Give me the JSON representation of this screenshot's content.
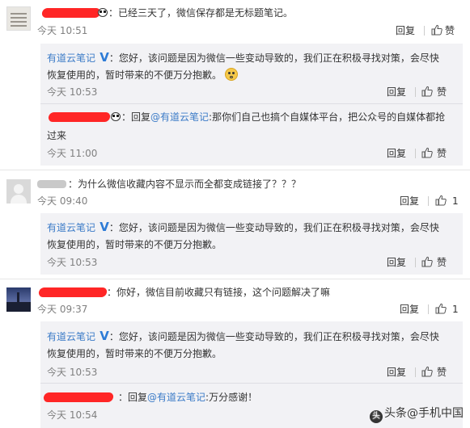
{
  "reply_label": "回复",
  "comments": [
    {
      "text": "已经三天了，微信保存都是无标题笔记。",
      "time": "今天 10:51",
      "replies": [
        {
          "author": "有道云笔记",
          "line1": "您好，该问题是因为微信一些变动导致的，我们正在积极寻找对策，会尽快",
          "line2": "恢复使用的，暂时带来的不便万分抱歉。",
          "time": "今天 10:53"
        },
        {
          "prefix": "回复",
          "mention": "@有道云笔记",
          "line1": ":那你们自己也搞个自媒体平台，把公众号的自媒体都抢",
          "line2": "过来",
          "time": "今天 11:00"
        }
      ]
    },
    {
      "text": "为什么微信收藏内容不显示而全都变成链接了？？？",
      "time": "今天 09:40",
      "likes": "1",
      "replies": [
        {
          "author": "有道云笔记",
          "line1": "您好，该问题是因为微信一些变动导致的，我们正在积极寻找对策，会尽快",
          "line2": "恢复使用的，暂时带来的不便万分抱歉。",
          "time": "今天 10:53"
        }
      ]
    },
    {
      "text": "你好，微信目前收藏只有链接，这个问题解决了嘛",
      "time": "今天 09:37",
      "likes": "1",
      "replies": [
        {
          "author": "有道云笔记",
          "line1": "您好，该问题是因为微信一些变动导致的，我们正在积极寻找对策，会尽快",
          "line2": "恢复使用的，暂时带来的不便万分抱歉。",
          "time": "今天 10:53"
        },
        {
          "prefix": "回复",
          "mention": "@有道云笔记",
          "line1": ":万分感谢！",
          "time": "今天 10:54"
        }
      ]
    }
  ],
  "watermark": "头条@手机中国",
  "colors": {
    "link": "#3b7bc7",
    "verified": "#2d7bd6",
    "redact": "#ff1a1a",
    "reply_bg": "#f2f2f5"
  }
}
